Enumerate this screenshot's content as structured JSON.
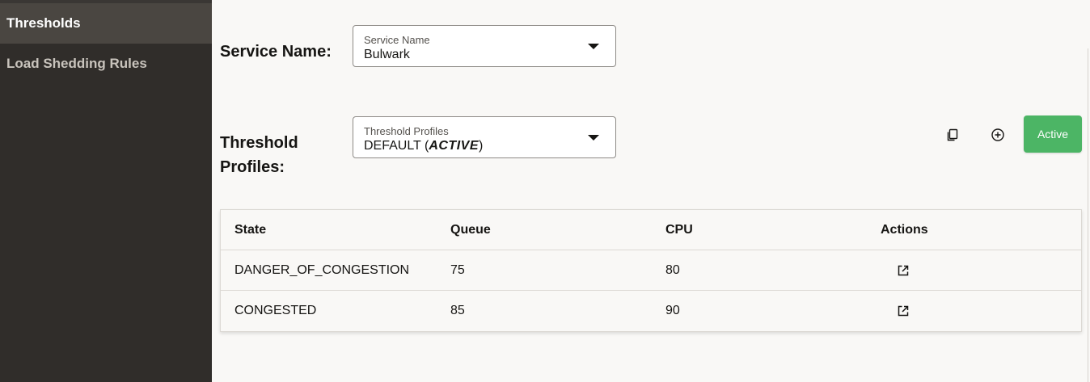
{
  "sidebar": {
    "items": [
      {
        "label": "Thresholds"
      },
      {
        "label": "Load Shedding Rules"
      }
    ]
  },
  "service": {
    "label": "Service Name:",
    "select_caption": "Service Name",
    "select_value": "Bulwark"
  },
  "profiles": {
    "label_line1": "Threshold",
    "label_line2": "Profiles:",
    "select_caption": "Threshold Profiles",
    "select_value_prefix": "DEFAULT (",
    "select_value_emph": "ACTIVE",
    "select_value_suffix": ")"
  },
  "toolbar": {
    "copy_icon": "copy-icon",
    "add_icon": "add-circle-icon",
    "active_label": "Active",
    "active_color": "#4cb565"
  },
  "table": {
    "headers": {
      "state": "State",
      "queue": "Queue",
      "cpu": "CPU",
      "actions": "Actions"
    },
    "rows": [
      {
        "state": "DANGER_OF_CONGESTION",
        "queue": "75",
        "cpu": "80",
        "action_icon": "open-external-icon"
      },
      {
        "state": "CONGESTED",
        "queue": "85",
        "cpu": "90",
        "action_icon": "open-external-icon"
      }
    ]
  }
}
